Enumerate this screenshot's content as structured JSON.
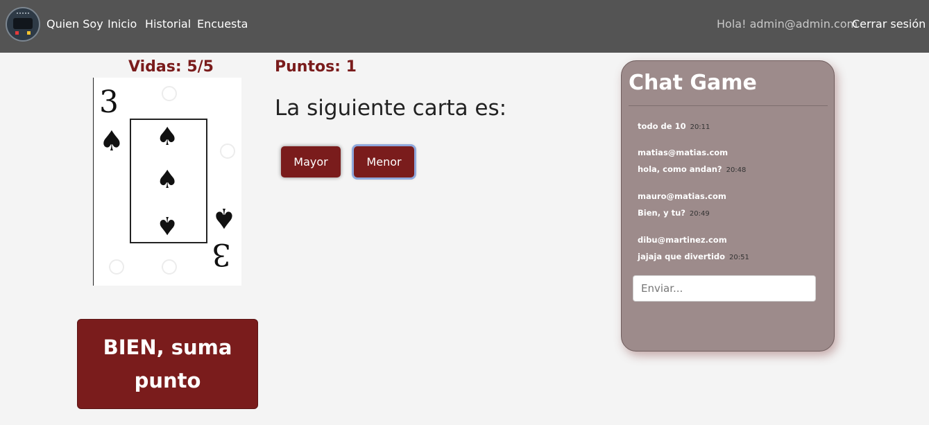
{
  "nav": {
    "links": [
      "Quien Soy",
      "Inicio",
      "Historial",
      "Encuesta"
    ],
    "greeting": "Hola! admin@admin.com",
    "logout": "Cerrar sesión"
  },
  "game": {
    "lives_label": "Vidas: 5/5",
    "points_label": "Puntos: 1",
    "card": {
      "rank": "3",
      "suit": "spades"
    },
    "question": "La siguiente carta es:",
    "higher_button": "Mayor",
    "lower_button": "Menor",
    "result_message": "BIEN, suma punto"
  },
  "chat": {
    "title": "Chat Game",
    "messages": [
      {
        "text": "todo de 10",
        "time": "20:11"
      },
      {
        "user": "matias@matias.com",
        "text": "hola, como andan?",
        "time": "20:48"
      },
      {
        "user": "mauro@matias.com",
        "text": "Bien, y tu?",
        "time": "20:49"
      },
      {
        "user": "dibu@martinez.com",
        "text": "jajaja que divertido",
        "time": "20:51"
      }
    ],
    "input_placeholder": "Enviar..."
  },
  "colors": {
    "navbar": "#545454",
    "accent": "#7a1c1c",
    "chat_bg": "#9d8b8b",
    "page_bg": "#f4f4f4"
  }
}
